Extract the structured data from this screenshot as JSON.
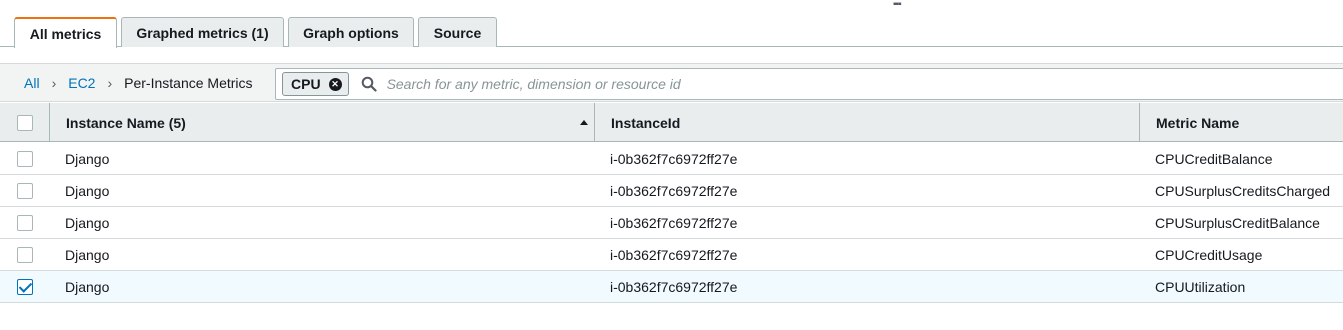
{
  "tabs": [
    {
      "label": "All metrics",
      "active": true
    },
    {
      "label": "Graphed metrics (1)",
      "active": false
    },
    {
      "label": "Graph options",
      "active": false
    },
    {
      "label": "Source",
      "active": false
    }
  ],
  "breadcrumb": {
    "items": [
      "All",
      "EC2",
      "Per-Instance Metrics"
    ],
    "separator": "›"
  },
  "search": {
    "token": "CPU",
    "placeholder": "Search for any metric, dimension or resource id"
  },
  "table": {
    "columns": [
      "Instance Name (5)",
      "InstanceId",
      "Metric Name"
    ],
    "rows": [
      {
        "name": "Django",
        "id": "i-0b362f7c6972ff27e",
        "metric": "CPUCreditBalance",
        "checked": false
      },
      {
        "name": "Django",
        "id": "i-0b362f7c6972ff27e",
        "metric": "CPUSurplusCreditsCharged",
        "checked": false
      },
      {
        "name": "Django",
        "id": "i-0b362f7c6972ff27e",
        "metric": "CPUSurplusCreditBalance",
        "checked": false
      },
      {
        "name": "Django",
        "id": "i-0b362f7c6972ff27e",
        "metric": "CPUCreditUsage",
        "checked": false
      },
      {
        "name": "Django",
        "id": "i-0b362f7c6972ff27e",
        "metric": "CPUUtilization",
        "checked": true
      }
    ]
  },
  "colors": {
    "accent_tab": "#ec7211",
    "link": "#0073bb",
    "selected_row": "#f1faff"
  }
}
